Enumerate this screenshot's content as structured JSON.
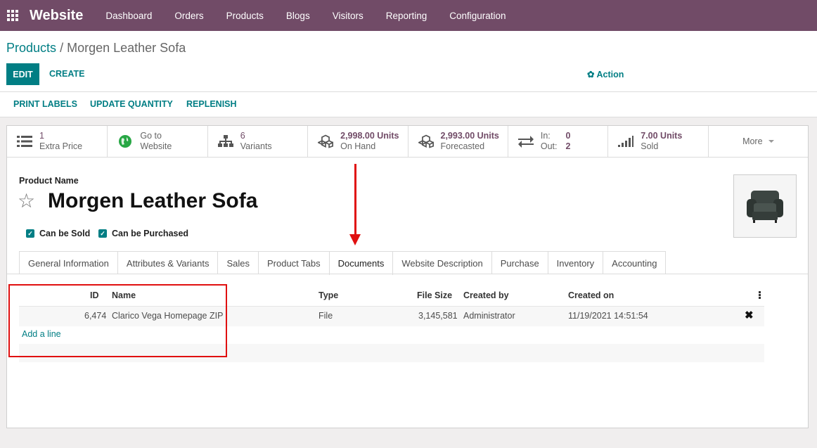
{
  "nav": {
    "brand": "Website",
    "items": [
      "Dashboard",
      "Orders",
      "Products",
      "Blogs",
      "Visitors",
      "Reporting",
      "Configuration"
    ]
  },
  "breadcrumb": {
    "parent": "Products",
    "separator": "/",
    "current": "Morgen Leather Sofa"
  },
  "buttons": {
    "edit": "EDIT",
    "create": "CREATE",
    "action": "Action"
  },
  "status_buttons": [
    "PRINT LABELS",
    "UPDATE QUANTITY",
    "REPLENISH"
  ],
  "smart_buttons": {
    "extra_price": {
      "value": "1",
      "label": "Extra Price"
    },
    "website": {
      "line1": "Go to",
      "line2": "Website"
    },
    "variants": {
      "value": "6",
      "label": "Variants"
    },
    "on_hand": {
      "value": "2,998.00 Units",
      "label": "On Hand"
    },
    "forecasted": {
      "value": "2,993.00 Units",
      "label": "Forecasted"
    },
    "in_out": {
      "in_label": "In:",
      "in_value": "0",
      "out_label": "Out:",
      "out_value": "2"
    },
    "sold": {
      "value": "7.00 Units",
      "label": "Sold"
    },
    "more": "More"
  },
  "form": {
    "product_name_label": "Product Name",
    "product_name": "Morgen Leather Sofa",
    "can_be_sold": "Can be Sold",
    "can_be_purchased": "Can be Purchased"
  },
  "tabs": [
    "General Information",
    "Attributes & Variants",
    "Sales",
    "Product Tabs",
    "Documents",
    "Website Description",
    "Purchase",
    "Inventory",
    "Accounting"
  ],
  "active_tab": "Documents",
  "documents": {
    "columns": {
      "id": "ID",
      "name": "Name",
      "type": "Type",
      "file_size": "File Size",
      "created_by": "Created by",
      "created_on": "Created on"
    },
    "rows": [
      {
        "id": "6,474",
        "name": "Clarico Vega Homepage ZIP",
        "type": "File",
        "file_size": "3,145,581",
        "created_by": "Administrator",
        "created_on": "11/19/2021 14:51:54"
      }
    ],
    "add_line": "Add a line"
  },
  "colors": {
    "navbar": "#714b67",
    "accent": "#017e84",
    "annotation": "#e01010"
  }
}
